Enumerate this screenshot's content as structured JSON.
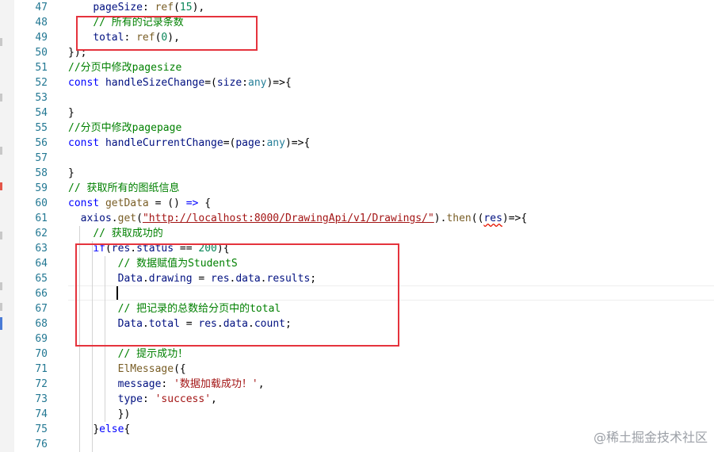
{
  "line_numbers": [
    "47",
    "48",
    "49",
    "50",
    "51",
    "52",
    "53",
    "54",
    "55",
    "56",
    "57",
    "58",
    "59",
    "60",
    "61",
    "62",
    "63",
    "64",
    "65",
    "66",
    "67",
    "68",
    "69",
    "70",
    "71",
    "72",
    "73",
    "74",
    "75",
    "76"
  ],
  "code": {
    "l47": [
      "pageSize",
      ": ",
      "ref",
      "(",
      "15",
      "),"
    ],
    "l48": [
      "// 所有的记录条数"
    ],
    "l49": [
      "total",
      ": ",
      "ref",
      "(",
      "0",
      "),"
    ],
    "l50": [
      "});"
    ],
    "l51": [
      "//分页中修改pagesize"
    ],
    "l52": [
      "const",
      " ",
      "handleSizeChange",
      "=(",
      "size",
      ":",
      "any",
      ")=>{"
    ],
    "l54": [
      "}"
    ],
    "l55": [
      "//分页中修改pagepage"
    ],
    "l56": [
      "const",
      " ",
      "handleCurrentChange",
      "=(",
      "page",
      ":",
      "any",
      ")=>{"
    ],
    "l58": [
      "}"
    ],
    "l59": [
      "// 获取所有的图纸信息"
    ],
    "l60": [
      "const",
      " ",
      "getData",
      " = () ",
      "=>",
      " {"
    ],
    "l61": [
      "axios",
      ".",
      "get",
      "(",
      "\"http://localhost:8000/DrawingApi/v1/Drawings/\"",
      ").",
      "then",
      "((",
      "res",
      ")=>{"
    ],
    "l62": [
      "// 获取成功的"
    ],
    "l63": [
      "if",
      "(",
      "res",
      ".",
      "status",
      " == ",
      "200",
      "){"
    ],
    "l64": [
      "// 数据赋值为StudentS"
    ],
    "l65": [
      "Data",
      ".",
      "drawing",
      " = ",
      "res",
      ".",
      "data",
      ".",
      "results",
      ";"
    ],
    "l67": [
      "// 把记录的总数给分页中的total"
    ],
    "l68": [
      "Data",
      ".",
      "total",
      " = ",
      "res",
      ".",
      "data",
      ".",
      "count",
      ";"
    ],
    "l70": [
      "// 提示成功！"
    ],
    "l71": [
      "ElMessage",
      "({"
    ],
    "l72": [
      "message",
      ": ",
      "'数据加载成功！'",
      ","
    ],
    "l73": [
      "type",
      ": ",
      "'success'",
      ","
    ],
    "l74": [
      "})"
    ],
    "l75": [
      "}",
      "else",
      "{"
    ]
  },
  "watermark": "@稀土掘金技术社区"
}
